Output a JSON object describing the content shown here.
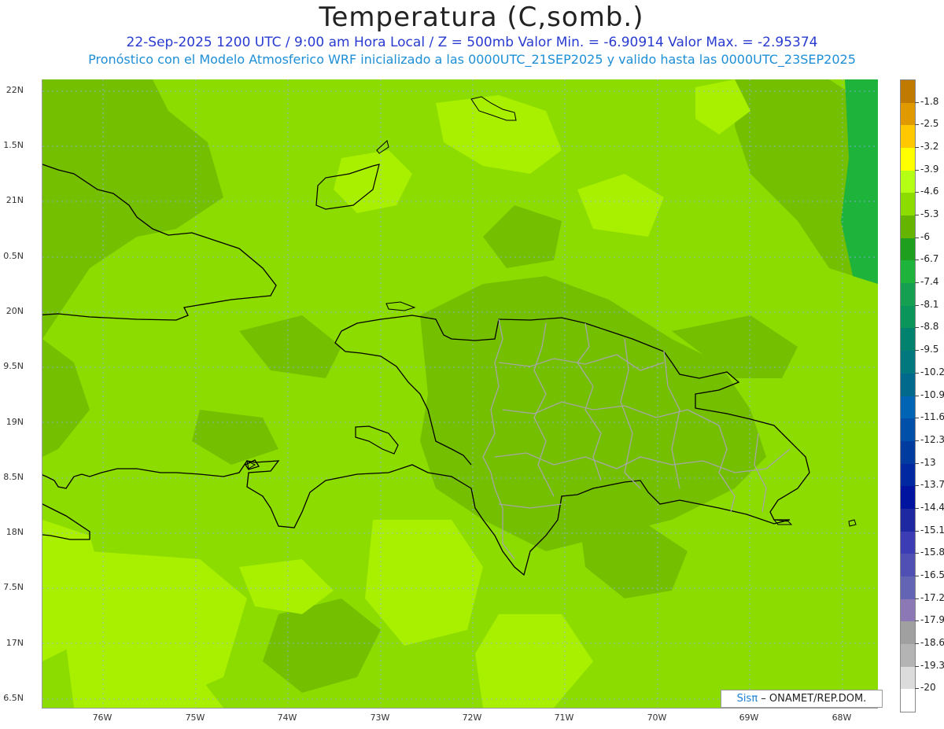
{
  "header": {
    "title": "Temperatura (C,somb.)",
    "line1": "22-Sep-2025  1200 UTC / 9:00 am Hora Local / Z = 500mb  Valor Min. = -6.90914  Valor Max. = -2.95374",
    "line2": "Pronóstico con el Modelo Atmosferico WRF inicializado a las 0000UTC_21SEP2025 y valido hasta las  0000UTC_23SEP2025"
  },
  "axes": {
    "lat_labels": [
      "22N",
      "1.5N",
      "21N",
      "0.5N",
      "20N",
      "9.5N",
      "19N",
      "8.5N",
      "18N",
      "7.5N",
      "17N",
      "6.5N"
    ],
    "lon_labels": [
      "76W",
      "75W",
      "74W",
      "73W",
      "72W",
      "71W",
      "70W",
      "69W",
      "68W"
    ]
  },
  "colorbar": {
    "labels": [
      "-1.8",
      "-2.5",
      "-3.2",
      "-3.9",
      "-4.6",
      "-5.3",
      "-6",
      "-6.7",
      "-7.4",
      "-8.1",
      "-8.8",
      "-9.5",
      "-10.2",
      "-10.9",
      "-11.6",
      "-12.3",
      "-13",
      "-13.7",
      "-14.4",
      "-15.1",
      "-15.8",
      "-16.5",
      "-17.2",
      "-17.9",
      "-18.6",
      "-19.3",
      "-20"
    ],
    "colors": [
      "#c07a00",
      "#e09a00",
      "#ffc800",
      "#ffff00",
      "#b4ff14",
      "#8cdc00",
      "#64b400",
      "#1ea01e",
      "#1eb43c",
      "#14a050",
      "#0a965a",
      "#00826e",
      "#00787d",
      "#00698c",
      "#0064b4",
      "#0050aa",
      "#003ca0",
      "#0028a0",
      "#0014a0",
      "#1e28a0",
      "#3c3cb4",
      "#5050b4",
      "#6464b4",
      "#8c78b4",
      "#a0a0a0",
      "#b4b4b4",
      "#dcdcdc",
      "#ffffff"
    ]
  },
  "credit": {
    "brand": "Sis",
    "pi": "π",
    "text": "– ONAMET/REP.DOM."
  }
}
